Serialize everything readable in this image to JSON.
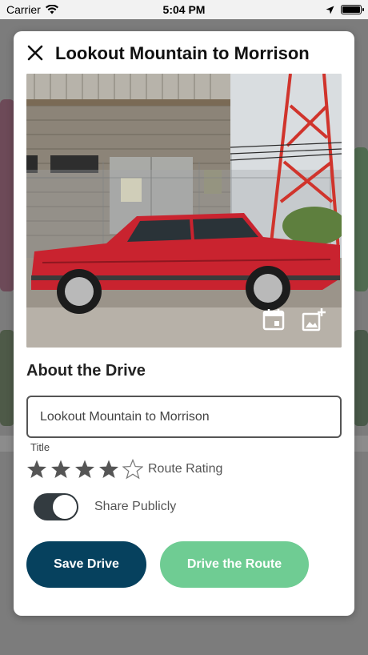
{
  "status_bar": {
    "carrier": "Carrier",
    "time": "5:04 PM",
    "wifi_icon": "wifi-icon",
    "location_icon": "location-arrow-icon",
    "battery_icon": "battery-icon"
  },
  "modal": {
    "title": "Lookout Mountain to Morrison",
    "close_icon": "close-icon",
    "photo": {
      "description_icon_calendar": "calendar-icon",
      "description_icon_add_image": "add-image-icon"
    },
    "section_title": "About the Drive",
    "title_field": {
      "value": "Lookout Mountain to Morrison",
      "caption": "Title"
    },
    "rating": {
      "value": 4,
      "max": 5,
      "label": "Route Rating"
    },
    "share": {
      "label": "Share Publicly",
      "enabled": true
    },
    "buttons": {
      "save_label": "Save Drive",
      "drive_label": "Drive the Route"
    }
  },
  "colors": {
    "primary": "#06415e",
    "accent": "#6fcc93",
    "toggle_on": "#333b40"
  }
}
